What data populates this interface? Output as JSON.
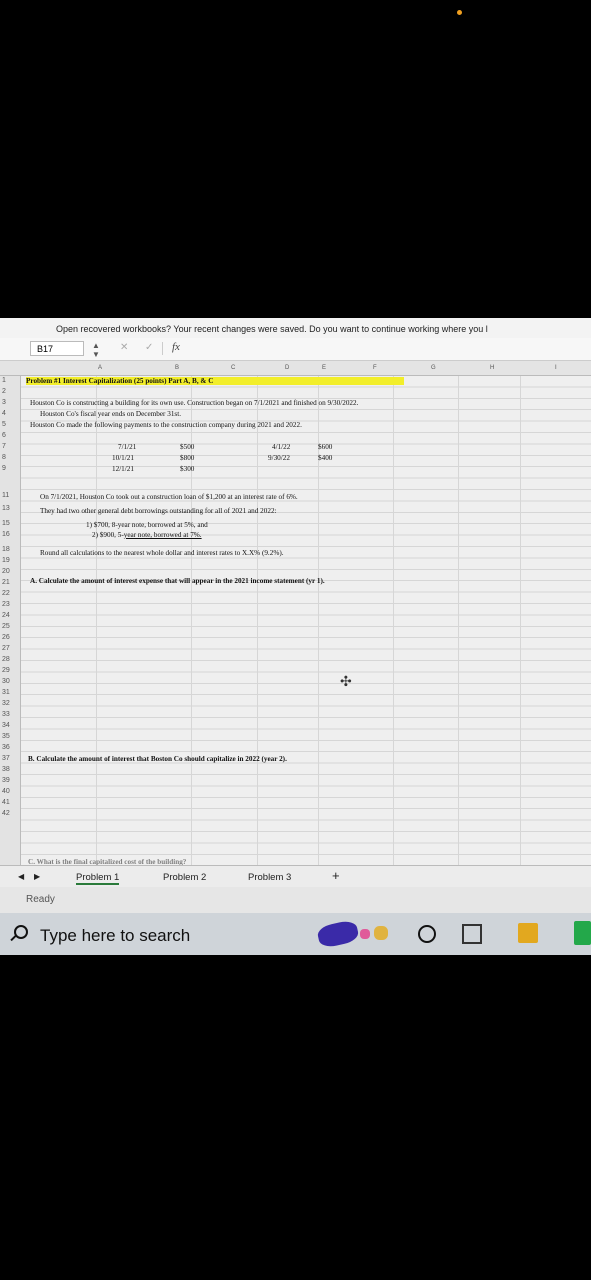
{
  "message_bar": {
    "text": "Open recovered workbooks?  Your recent changes were saved. Do you want to continue working where you l"
  },
  "formula_bar": {
    "name_box": "B17",
    "fx": "fx"
  },
  "columns": [
    "A",
    "B",
    "C",
    "D",
    "E",
    "F",
    "G",
    "H",
    "I"
  ],
  "rows": [
    "1",
    "2",
    "3",
    "4",
    "5",
    "6",
    "7",
    "8",
    "9",
    "11",
    "13",
    "15",
    "16",
    "18",
    "19",
    "20",
    "21",
    "22",
    "23",
    "24",
    "25",
    "26",
    "27",
    "28",
    "29",
    "30",
    "31",
    "32",
    "33",
    "34",
    "35",
    "36",
    "37",
    "38",
    "39",
    "40",
    "41",
    "42"
  ],
  "sheet": {
    "title": "Problem #1 Interest Capitalization (25 points) Part A, B, & C",
    "line3": "Houston Co is constructing a building for its own use. Construction began on 7/1/2021 and finished on 9/30/2022.",
    "line4": "Houston Co's fiscal year ends on December 31st.",
    "line5": "Houston Co made the following payments to the construction company during 2021 and 2022.",
    "payments_left": [
      {
        "date": "7/1/21",
        "amount": "$500"
      },
      {
        "date": "10/1/21",
        "amount": "$800"
      },
      {
        "date": "12/1/21",
        "amount": "$300"
      }
    ],
    "payments_right": [
      {
        "date": "4/1/22",
        "amount": "$600"
      },
      {
        "date": "9/30/22",
        "amount": "$400"
      }
    ],
    "line11": "On 7/1/2021, Houston Co took out a construction loan of $1,200 at an interest rate of 6%.",
    "line13": "They had two other general debt borrowings outstanding for all of 2021 and 2022:",
    "line15": "1) $700, 8-year note, borrowed at 5%, and",
    "line16_a": "2) $900, 5-",
    "line16_b": "year note, borrowed at 7%.",
    "line18": "Round all calculations to the nearest whole dollar and interest rates to X.X% (9.2%).",
    "line20": "A. Calculate the amount of interest expense that will appear in the 2021 income statement (yr 1).",
    "line34": "B. Calculate the amount of interest that Boston Co should capitalize in 2022 (year 2).",
    "line42": "C. What is the final capitalized cost of the building?"
  },
  "tabs": [
    "Problem 1",
    "Problem 2",
    "Problem 3"
  ],
  "status": "Ready",
  "taskbar": {
    "search_placeholder": "Type here to search"
  }
}
